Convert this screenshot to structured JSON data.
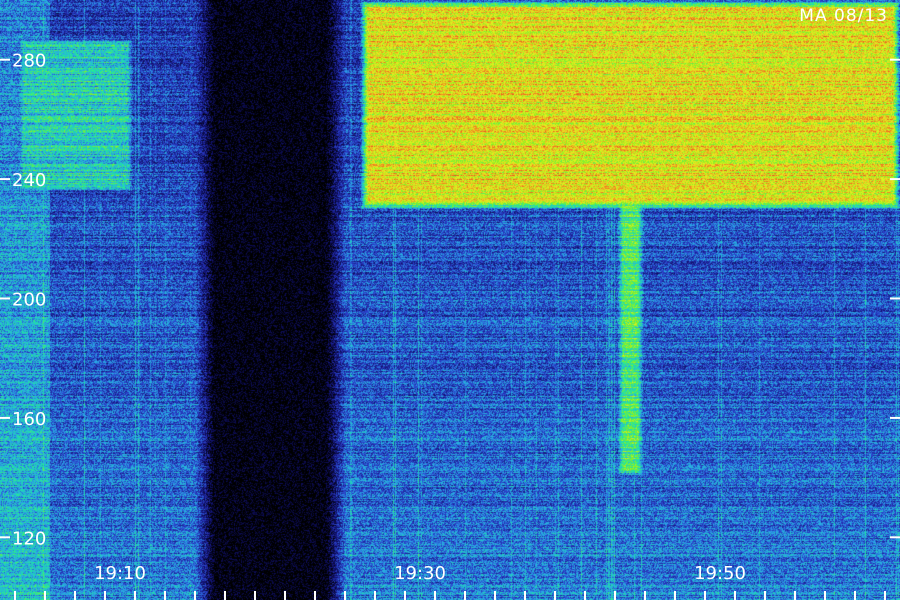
{
  "header": {
    "station_date_label": "MA 08/13"
  },
  "colors": {
    "background": "#000000",
    "axis": "#ffffff",
    "colormap": [
      "#000000",
      "#10106a",
      "#2a3cc8",
      "#2aa8e8",
      "#1ee8a0",
      "#8cf020",
      "#e8f020",
      "#f08020",
      "#e02020"
    ]
  },
  "chart_data": {
    "type": "heatmap",
    "title": "",
    "xlabel": "",
    "ylabel": "",
    "x_ticks": [
      "19:10",
      "19:30",
      "19:50"
    ],
    "y_ticks": [
      120,
      160,
      200,
      240,
      280
    ],
    "x_range_minutes": [
      19.0,
      20.0
    ],
    "y_range": [
      99,
      300
    ],
    "x_min_time": "19:02",
    "x_max_time": "19:62",
    "features": [
      {
        "name": "gap",
        "start": "19:15",
        "end": "19:25",
        "intensity": 0.02
      },
      {
        "name": "band",
        "start": "19:03",
        "end": "19:11",
        "y_low": 235,
        "y_high": 288,
        "intensity": 0.45
      },
      {
        "name": "band",
        "start": "19:26",
        "end": "19:62",
        "y_low": 230,
        "y_high": 300,
        "intensity": 0.75
      },
      {
        "name": "burst",
        "start": "19:43",
        "end": "19:45",
        "y_low": 140,
        "y_high": 300,
        "intensity": 0.55
      }
    ]
  }
}
